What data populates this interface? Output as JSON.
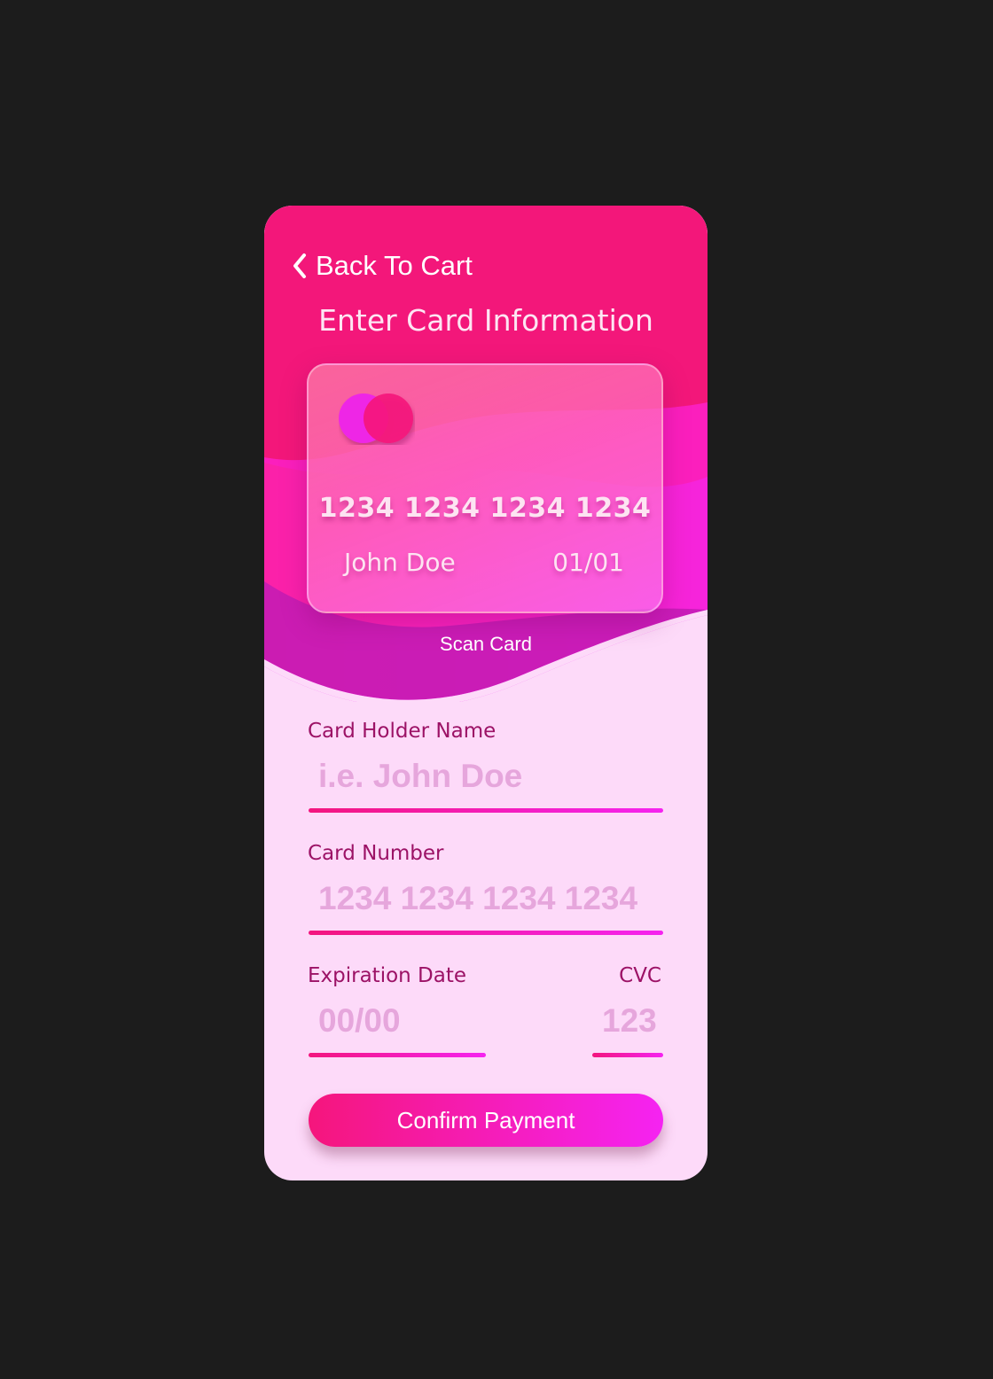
{
  "header": {
    "back_label": "Back To Cart",
    "title": "Enter Card Information"
  },
  "card_preview": {
    "number": "1234 1234 1234 1234",
    "holder": "John Doe",
    "expiry": "01/01"
  },
  "scan_label": "Scan Card",
  "form": {
    "holder": {
      "label": "Card Holder Name",
      "placeholder": "i.e. John Doe"
    },
    "number": {
      "label": "Card Number",
      "placeholder": "1234 1234 1234 1234"
    },
    "expiry": {
      "label": "Expiration Date",
      "placeholder": "00/00"
    },
    "cvc": {
      "label": "CVC",
      "placeholder": "123"
    }
  },
  "confirm_label": "Confirm Payment",
  "colors": {
    "page_background": "#1c1c1c",
    "header_pink": "#f3177a",
    "wave_magenta": "#fb1fbd",
    "wave_violet": "#f525f0",
    "form_background": "#fddaf9",
    "label_text": "#9c1266",
    "placeholder_text": "#e6a6dc",
    "accent_gradient_start": "#f5167c",
    "accent_gradient_end": "#f523f2"
  },
  "icons": {
    "back": "chevron-left-icon",
    "card_brand": "card-brand-logo-icon"
  }
}
